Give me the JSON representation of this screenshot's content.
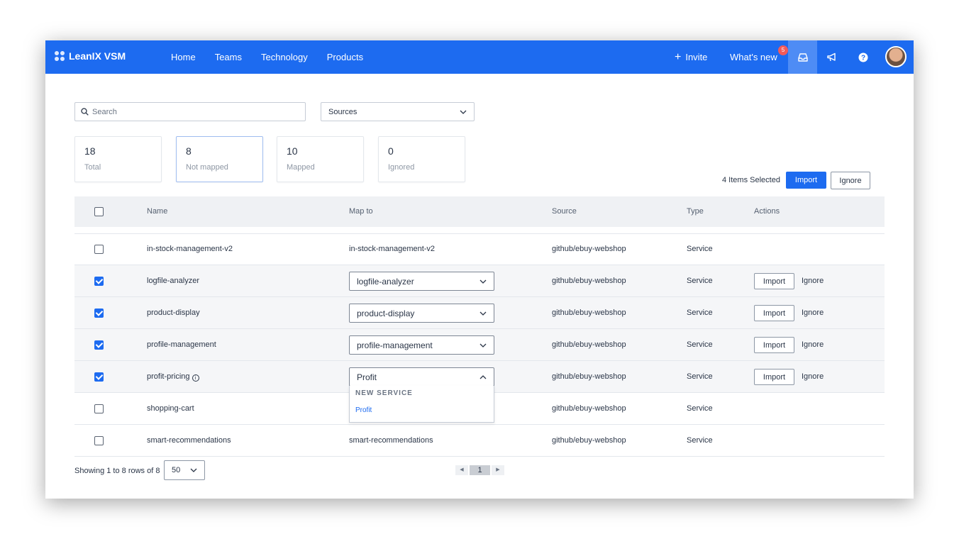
{
  "brand": {
    "name": "LeanIX VSM"
  },
  "nav": [
    "Home",
    "Teams",
    "Technology",
    "Products"
  ],
  "header": {
    "invite_label": "Invite",
    "whats_new_label": "What's new",
    "whats_new_count": "5"
  },
  "search": {
    "placeholder": "Search",
    "value": ""
  },
  "sources_filter": {
    "label": "Sources"
  },
  "stats": [
    {
      "value": "18",
      "label": "Total"
    },
    {
      "value": "8",
      "label": "Not mapped"
    },
    {
      "value": "10",
      "label": "Mapped"
    },
    {
      "value": "0",
      "label": "Ignored"
    }
  ],
  "bulk": {
    "selected_text": "4 Items Selected",
    "import_label": "Import",
    "ignore_label": "Ignore"
  },
  "table": {
    "columns": {
      "name": "Name",
      "map_to": "Map to",
      "source": "Source",
      "type": "Type",
      "actions": "Actions"
    },
    "rows": [
      {
        "name": "in-stock-management-v2",
        "map_to": "in-stock-management-v2",
        "source": "github/ebuy-webshop",
        "type": "Service",
        "checked": false
      },
      {
        "name": "logfile-analyzer",
        "map_to": "logfile-analyzer",
        "source": "github/ebuy-webshop",
        "type": "Service",
        "checked": true,
        "import": "Import",
        "ignore": "Ignore"
      },
      {
        "name": "product-display",
        "map_to": "product-display",
        "source": "github/ebuy-webshop",
        "type": "Service",
        "checked": true,
        "import": "Import",
        "ignore": "Ignore"
      },
      {
        "name": "profile-management",
        "map_to": "profile-management",
        "source": "github/ebuy-webshop",
        "type": "Service",
        "checked": true,
        "import": "Import",
        "ignore": "Ignore"
      },
      {
        "name": "profit-pricing",
        "map_to": "Profit",
        "source": "github/ebuy-webshop",
        "type": "Service",
        "checked": true,
        "import": "Import",
        "ignore": "Ignore"
      },
      {
        "name": "shopping-cart",
        "map_to": "",
        "source": "github/ebuy-webshop",
        "type": "Service",
        "checked": false
      },
      {
        "name": "smart-recommendations",
        "map_to": "smart-recommendations",
        "source": "github/ebuy-webshop",
        "type": "Service",
        "checked": false
      }
    ]
  },
  "dropdown_popup": {
    "header": "NEW SERVICE",
    "option": "Profit"
  },
  "pagination": {
    "showing_text": "Showing 1 to 8 rows of 8",
    "page_size": "50",
    "current_page": "1"
  },
  "colors": {
    "brand_blue": "#1d6bf0",
    "badge_red": "#f25a5a"
  }
}
